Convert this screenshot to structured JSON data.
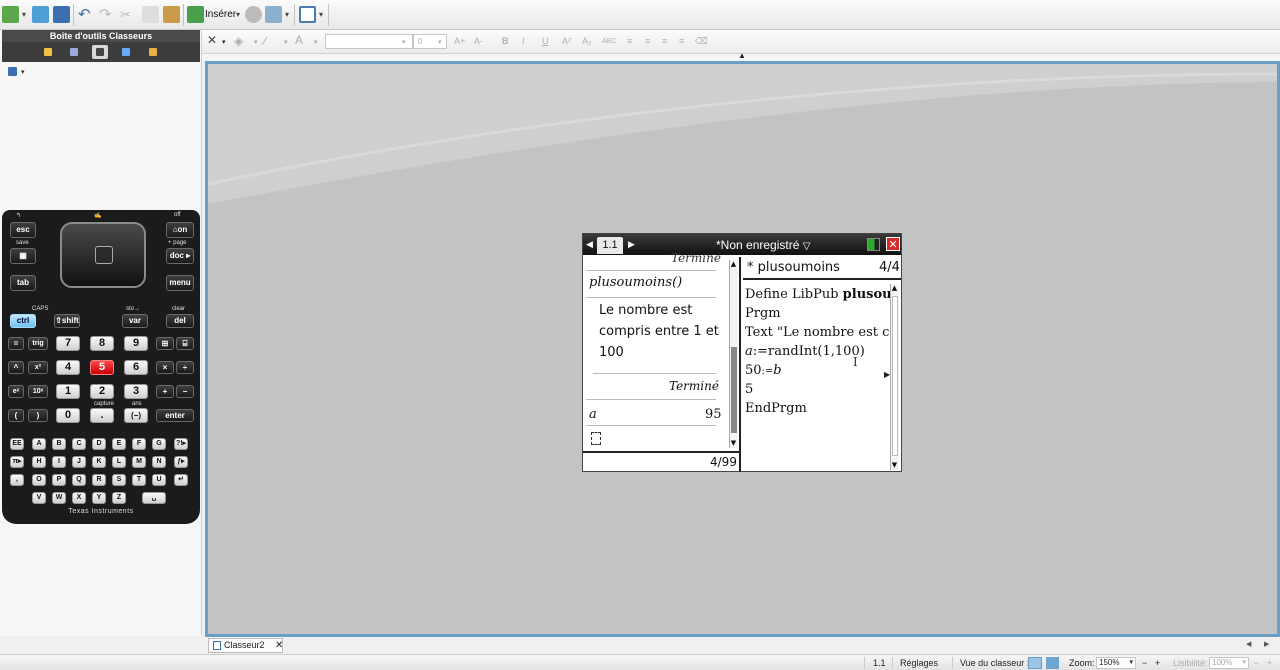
{
  "toolbar": {
    "insert_label": "Insérer"
  },
  "left_panel": {
    "title": "Boîte d'outils Classeurs"
  },
  "keypad": {
    "esc": "esc",
    "on": "⌂on",
    "doc": "doc ▸",
    "tab": "tab",
    "menu": "menu",
    "ctrl": "ctrl",
    "shift": "⇧shift",
    "var": "var",
    "del": "del",
    "eq": "=",
    "trig": "trig",
    "k7": "7",
    "k8": "8",
    "k9": "9",
    "pow": "^",
    "sq": "x²",
    "k4": "4",
    "k5": "5",
    "k6": "6",
    "ex": "eˣ",
    "tenx": "10ˣ",
    "k1": "1",
    "k2": "2",
    "k3": "3",
    "lp": "(",
    "rp": ")",
    "k0": "0",
    "dot": ".",
    "neg": "(−)",
    "enter": "enter",
    "times": "×",
    "div": "÷",
    "plus": "+",
    "minus": "−",
    "lbl_off": "off",
    "lbl_save": "save",
    "lbl_page": "+ page",
    "lbl_caps": "CAPS",
    "lbl_sto": "sto→",
    "lbl_clear": "clear",
    "lbl_capture": "capture",
    "lbl_ans": "ans",
    "letters": [
      "EE",
      "A",
      "B",
      "C",
      "D",
      "E",
      "F",
      "G",
      "?!▸",
      "π▸",
      "H",
      "I",
      "J",
      "K",
      "L",
      "M",
      "N",
      "ƒ▸",
      ",",
      "O",
      "P",
      "Q",
      "R",
      "S",
      "T",
      "U",
      "↵",
      "V",
      "W",
      "X",
      "Y",
      "Z",
      "␣"
    ],
    "brand": "Texas Instruments"
  },
  "screen": {
    "tab": "1.1",
    "title": "*Non enregistré",
    "calc": {
      "cut_top": "Terminé",
      "call": "plusoumoins()",
      "msg1": "Le nombre est",
      "msg2": "compris entre 1 et",
      "msg3": "100",
      "done": "Terminé",
      "var_name": "a",
      "var_value": "95",
      "counter": "4/99"
    },
    "editor": {
      "prog_name": "* plusoumoins",
      "page": "4/4",
      "line1_a": "Define LibPub ",
      "line1_b": "plusou",
      "line2": "Prgm",
      "line3": "Text \"Le nombre est c",
      "line4_a": "a",
      "line4_b": ":=randInt(1,100)",
      "line5_a": "50",
      "line5_b": ":=",
      "line5_c": "b",
      "line6": "5",
      "line7": "EndPrgm"
    }
  },
  "bottom": {
    "doc_tab": "Classeur2"
  },
  "statusbar": {
    "page": "1.1",
    "settings": "Réglages",
    "view_label": "Vue du classeur :",
    "zoom_label": "Zoom:",
    "zoom_value": "150%",
    "legibility_label": "Lisibilité:",
    "legibility_value": "100%"
  },
  "colors": {
    "frame_border": "#6b9ec5",
    "close_red": "#d62b2b",
    "key_red": "#e00000"
  }
}
